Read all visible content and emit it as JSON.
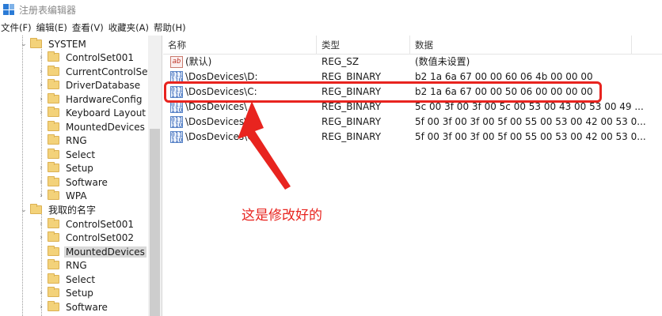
{
  "window": {
    "title": "注册表编辑器"
  },
  "menu": [
    "文件(F)",
    "编辑(E)",
    "查看(V)",
    "收藏夹(A)",
    "帮助(H)"
  ],
  "tree": {
    "root_label": "SYSTEM",
    "root_children": [
      "ControlSet001",
      "CurrentControlSet",
      "DriverDatabase",
      "HardwareConfig",
      "Keyboard Layout",
      "MountedDevices",
      "RNG",
      "Select",
      "Setup",
      "Software",
      "WPA"
    ],
    "second_label": "我取的名字",
    "second_children": [
      "ControlSet001",
      "ControlSet002",
      "MountedDevices",
      "RNG",
      "Select",
      "Setup",
      "Software"
    ],
    "selected": "MountedDevices"
  },
  "columns": {
    "name": "名称",
    "type": "类型",
    "data": "数据"
  },
  "values": [
    {
      "name": "(默认)",
      "type": "REG_SZ",
      "data": "(数值未设置)",
      "icon": "string-value-icon"
    },
    {
      "name": "\\DosDevices\\D:",
      "type": "REG_BINARY",
      "data": "b2 1a 6a 67 00 00 60 06 4b 00 00 00",
      "icon": "binary-value-icon"
    },
    {
      "name": "\\DosDevices\\C:",
      "type": "REG_BINARY",
      "data": "b2 1a 6a 67 00 00 50 06 00 00 00 00",
      "icon": "binary-value-icon"
    },
    {
      "name": "\\DosDevices\\",
      "type": "REG_BINARY",
      "data": "5c 00 3f 00 3f 00 5c 00 53 00 43 00 53 00 49 ...",
      "icon": "binary-value-icon"
    },
    {
      "name": "\\DosDevices\\",
      "type": "REG_BINARY",
      "data": "5f 00 3f 00 3f 00 5f 00 55 00 53 00 42 00 53 0...",
      "icon": "binary-value-icon"
    },
    {
      "name": "\\DosDevices\\G:",
      "type": "REG_BINARY",
      "data": "5f 00 3f 00 3f 00 5f 00 55 00 53 00 42 00 53 0...",
      "icon": "binary-value-icon"
    }
  ],
  "annotation": {
    "text": "这是修改好的",
    "color": "#e8241f"
  }
}
